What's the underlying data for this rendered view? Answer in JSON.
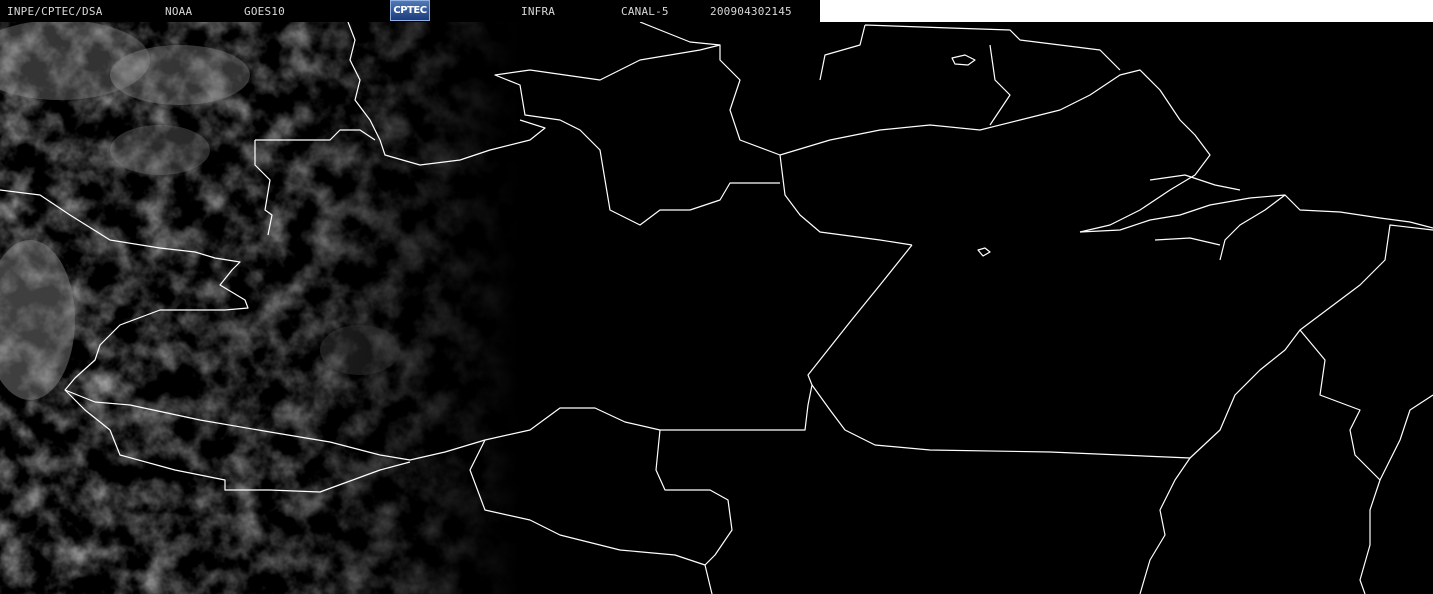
{
  "header": {
    "source": "INPE/CPTEC/DSA",
    "agency": "NOAA",
    "satellite": "GOES10",
    "logo_text": "CPTEC",
    "product": "INFRA",
    "channel": "CANAL-5",
    "datetime": "200904302145"
  },
  "colors": {
    "background": "#000000",
    "borders": "#ffffff",
    "clouds": "#7a7a7a",
    "header_text": "#d8d8d8"
  },
  "map": {
    "type": "satellite-infrared-image",
    "cloud_cover": "cloud field in the western third of the image, clear elsewhere"
  }
}
